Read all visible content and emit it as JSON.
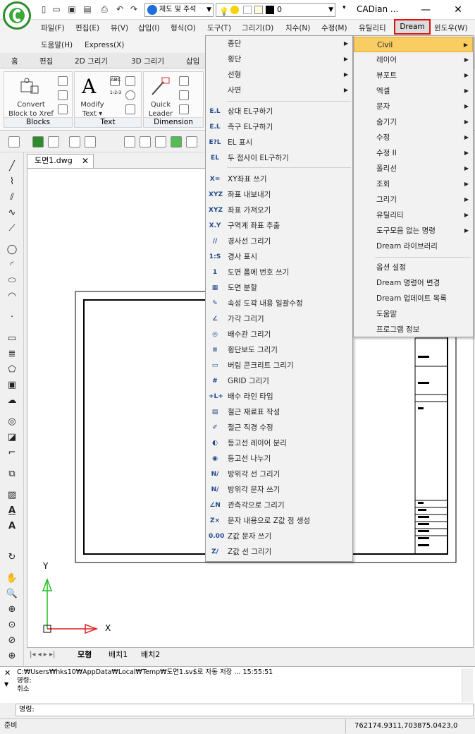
{
  "app": {
    "title": "CADian ...",
    "layer_combo": "제도 및 주석",
    "layer_state": "0"
  },
  "window_controls": [
    "—",
    "☐",
    "✕"
  ],
  "menu": {
    "items": [
      "파일(F)",
      "편집(E)",
      "뷰(V)",
      "삽입(I)",
      "형식(O)",
      "도구(T)",
      "그리기(D)",
      "치수(N)",
      "수정(M)",
      "유틸리티",
      "Dream",
      "윈도우(W)"
    ],
    "row2": [
      "도움말(H)",
      "Express(X)"
    ]
  },
  "ribbon": {
    "tabs": [
      "홈",
      "편집",
      "2D 그리기",
      "3D 그리기",
      "삽입"
    ],
    "groups": [
      {
        "name": "Blocks",
        "buttons": [
          "Convert",
          "Block to Xref"
        ]
      },
      {
        "name": "Text",
        "buttons": [
          "Modify",
          "Text ▾"
        ]
      },
      {
        "name": "Dimension",
        "buttons": [
          "Quick",
          "Leader"
        ]
      }
    ]
  },
  "document": {
    "tab": "도면1.dwg",
    "layout_tabs": [
      "모형",
      "배치1",
      "배치2"
    ],
    "axis_x": "X",
    "axis_y": "Y"
  },
  "command": {
    "lines": [
      "C:₩Users₩hks10₩AppData₩Local₩Temp₩도면1.sv$로 자동 저장 ... 15:55:51",
      "명령:",
      "취소"
    ],
    "prompt": "명령:"
  },
  "status": {
    "left": "준비",
    "coords": "762174.9311,703875.0423,0"
  },
  "dropdown": {
    "submenus": [
      "종단",
      "횡단",
      "선형",
      "사면"
    ],
    "items": [
      {
        "icon": "E.L",
        "label": "상대 EL구하기"
      },
      {
        "icon": "E.L",
        "label": "측구 EL구하기"
      },
      {
        "icon": "E?L",
        "label": "EL 표시"
      },
      {
        "icon": "EL",
        "label": "두 점사이 EL구하기"
      },
      {
        "icon": "X=",
        "label": "XY좌표 쓰기"
      },
      {
        "icon": "XYZ",
        "label": "좌표 내보내기"
      },
      {
        "icon": "XYZ",
        "label": "좌표 가져오기"
      },
      {
        "icon": "X.Y",
        "label": "구역계 좌표 추출"
      },
      {
        "icon": "//",
        "label": "경사선 그리기"
      },
      {
        "icon": "1:S",
        "label": "경사 표시"
      },
      {
        "icon": "1",
        "label": "도면 폼에 번호 쓰기"
      },
      {
        "icon": "▦",
        "label": "도면 분할"
      },
      {
        "icon": "✎",
        "label": "속성 도곽 내용 일괄수정"
      },
      {
        "icon": "∠",
        "label": "가각 그리기"
      },
      {
        "icon": "◎",
        "label": "배수관 그리기"
      },
      {
        "icon": "≡",
        "label": "횡단보도 그리기"
      },
      {
        "icon": "▭",
        "label": "버림 콘크리트 그리기"
      },
      {
        "icon": "#",
        "label": "GRID 그리기"
      },
      {
        "icon": "+L+",
        "label": "배수 라인 타입"
      },
      {
        "icon": "▤",
        "label": "철근 재료표 작성"
      },
      {
        "icon": "✐",
        "label": "철근 직경 수정"
      },
      {
        "icon": "◐",
        "label": "등고선 레이어 분리"
      },
      {
        "icon": "◉",
        "label": "등고선 나누기"
      },
      {
        "icon": "N/",
        "label": "방위각 선 그리기"
      },
      {
        "icon": "N/",
        "label": "방위각 문자 쓰기"
      },
      {
        "icon": "∠N",
        "label": "관측각으로 그리기"
      },
      {
        "icon": "Z×",
        "label": "문자 내용으로 Z값 점 생성"
      },
      {
        "icon": "0.00",
        "label": "Z값 문자 쓰기"
      },
      {
        "icon": "Z/",
        "label": "Z값 선 그리기"
      }
    ]
  },
  "submenu": {
    "items": [
      {
        "label": "Civil",
        "arrow": true
      },
      {
        "label": "레이어",
        "arrow": true
      },
      {
        "label": "뷰포트",
        "arrow": true
      },
      {
        "label": "엑셀",
        "arrow": true
      },
      {
        "label": "문자",
        "arrow": true
      },
      {
        "label": "숨기기",
        "arrow": true
      },
      {
        "label": "수정",
        "arrow": true
      },
      {
        "label": "수정 II",
        "arrow": true
      },
      {
        "label": "폴리선",
        "arrow": true
      },
      {
        "label": "조회",
        "arrow": true
      },
      {
        "label": "그리기",
        "arrow": true
      },
      {
        "label": "유틸리티",
        "arrow": true
      },
      {
        "label": "도구모음 없는 명령",
        "arrow": true
      },
      {
        "label": "Dream 라이브러리",
        "arrow": false
      }
    ],
    "items2": [
      "옵션 설정",
      "Dream 명령어 변경",
      "Dream 업데이트 목록",
      "도움말",
      "프로그램 정보"
    ]
  },
  "colors": {
    "highlight": "#f9cd62",
    "dream_border": "#e01010",
    "axis_x": "#e02020",
    "axis_y": "#20c020"
  }
}
